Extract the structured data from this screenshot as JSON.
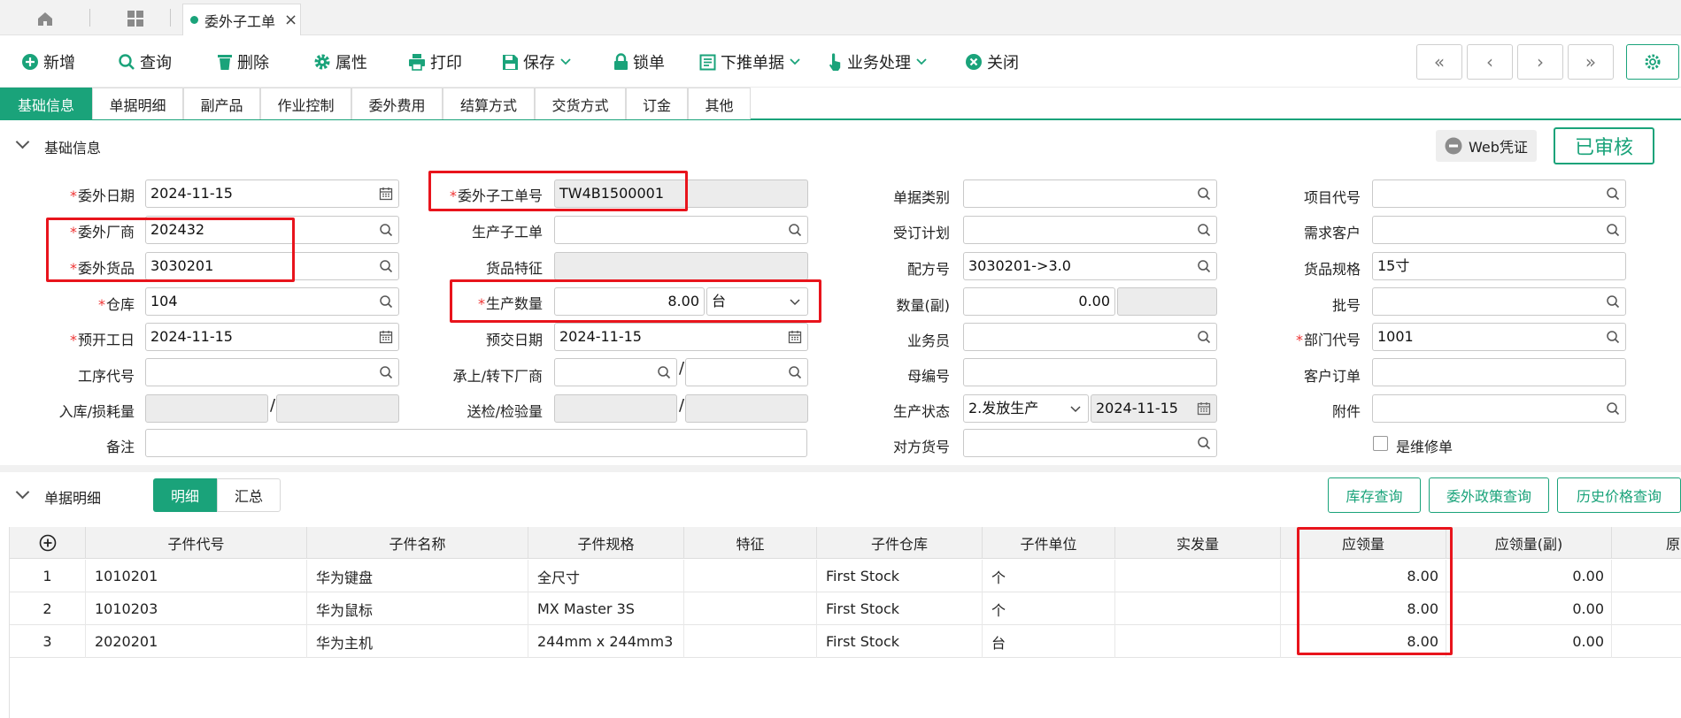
{
  "app": {
    "doc_tab_label": "委外子工单",
    "doc_tab_close": "×"
  },
  "toolbar": {
    "new": "新增",
    "query": "查询",
    "delete": "删除",
    "properties": "属性",
    "print": "打印",
    "save": "保存",
    "lock": "锁单",
    "push_down": "下推单据",
    "business": "业务处理",
    "close": "关闭",
    "nav_first": "«",
    "nav_prev": "‹",
    "nav_next": "›",
    "nav_last": "»"
  },
  "tabs": [
    "基础信息",
    "单据明细",
    "副产品",
    "作业控制",
    "委外费用",
    "结算方式",
    "交货方式",
    "订金",
    "其他"
  ],
  "section_basic": {
    "title": "基础信息",
    "web_voucher": "Web凭证",
    "status": "已审核"
  },
  "form": {
    "wai_date": {
      "label": "委外日期",
      "value": "2024-11-15"
    },
    "supplier": {
      "label": "委外厂商",
      "value": "202432"
    },
    "goods": {
      "label": "委外货品",
      "value": "3030201"
    },
    "warehouse": {
      "label": "仓库",
      "value": "104"
    },
    "start_date": {
      "label": "预开工日",
      "value": "2024-11-15"
    },
    "process_code": {
      "label": "工序代号",
      "value": ""
    },
    "in_loss": {
      "label": "入库/损耗量",
      "value1": "",
      "value2": ""
    },
    "remark": {
      "label": "备注",
      "value": ""
    },
    "sub_order_no": {
      "label": "委外子工单号",
      "value": "TW4B1500001"
    },
    "prod_sub_order": {
      "label": "生产子工单",
      "value": ""
    },
    "goods_feature": {
      "label": "货品特征",
      "value": ""
    },
    "prod_qty": {
      "label": "生产数量",
      "value": "8.00",
      "unit": "台"
    },
    "due_date": {
      "label": "预交日期",
      "value": "2024-11-15"
    },
    "up_down_vendor": {
      "label": "承上/转下厂商",
      "value1": "",
      "value2": ""
    },
    "inspect_qty": {
      "label": "送检/检验量",
      "value1": "",
      "value2": ""
    },
    "doc_type": {
      "label": "单据类别",
      "value": ""
    },
    "order_plan": {
      "label": "受订计划",
      "value": ""
    },
    "recipe_no": {
      "label": "配方号",
      "value": "3030201->3.0"
    },
    "qty_sub": {
      "label": "数量(副)",
      "value": "0.00",
      "value2": ""
    },
    "salesman": {
      "label": "业务员",
      "value": ""
    },
    "parent_no": {
      "label": "母编号",
      "value": ""
    },
    "prod_status": {
      "label": "生产状态",
      "value": "2.发放生产",
      "date": "2024-11-15"
    },
    "counter_goods": {
      "label": "对方货号",
      "value": ""
    },
    "project_code": {
      "label": "项目代号",
      "value": ""
    },
    "demand_customer": {
      "label": "需求客户",
      "value": ""
    },
    "goods_spec": {
      "label": "货品规格",
      "value": "15寸"
    },
    "batch_no": {
      "label": "批号",
      "value": ""
    },
    "dept_code": {
      "label": "部门代号",
      "value": "1001"
    },
    "customer_order": {
      "label": "客户订单",
      "value": ""
    },
    "attachment": {
      "label": "附件",
      "value": ""
    },
    "repair_order": {
      "label": "是维修单",
      "checked": false
    }
  },
  "section_detail": {
    "title": "单据明细",
    "seg_detail": "明细",
    "seg_summary": "汇总",
    "btn_stock": "库存查询",
    "btn_policy": "委外政策查询",
    "btn_history": "历史价格查询"
  },
  "grid": {
    "headers": [
      "子件代号",
      "子件名称",
      "子件规格",
      "特征",
      "子件仓库",
      "子件单位",
      "实发量",
      "应领量",
      "应领量(副)",
      "原"
    ],
    "rows": [
      [
        "1",
        "1010201",
        "华为键盘",
        "全尺寸",
        "",
        "First Stock",
        "个",
        "",
        "8.00",
        "0.00"
      ],
      [
        "2",
        "1010203",
        "华为鼠标",
        "MX Master 3S",
        "",
        "First Stock",
        "个",
        "",
        "8.00",
        "0.00"
      ],
      [
        "3",
        "2020201",
        "华为主机",
        "244mm x 244mm3",
        "",
        "First Stock",
        "台",
        "",
        "8.00",
        "0.00"
      ]
    ]
  },
  "colors": {
    "accent": "#1aa37a",
    "highlight": "#e8141c",
    "required": "#e33333"
  }
}
